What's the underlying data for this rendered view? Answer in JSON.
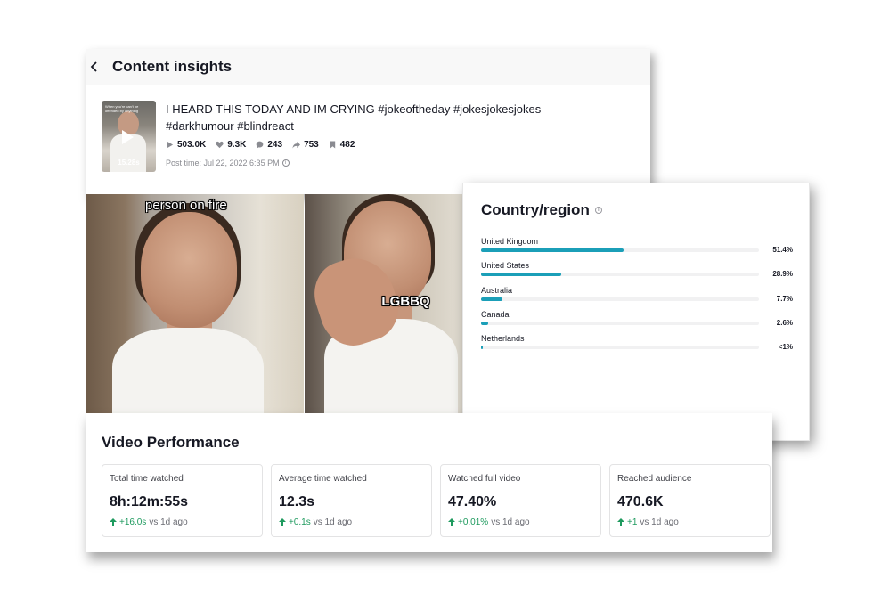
{
  "header": {
    "title": "Content insights",
    "back_icon": "chevron-left-icon"
  },
  "post": {
    "caption_line1": "I HEARD THIS TODAY AND IM CRYING #jokeoftheday #jokesjokesjokes",
    "caption_line2": "#darkhumour #blindreact",
    "thumbnail_caption": "When you're can't be offended by anything",
    "duration": "15.28s",
    "stats": {
      "views": "503.0K",
      "likes": "9.3K",
      "comments": "243",
      "shares": "753",
      "saves": "482"
    },
    "post_time": "Post time: Jul 22, 2022 6:35 PM"
  },
  "frames": {
    "overlay_1": "person on fire",
    "overlay_2": "LGBBQ"
  },
  "country": {
    "title": "Country/region",
    "accent_color": "#1b9fb8",
    "items": [
      {
        "name": "United Kingdom",
        "pct": "51.4%",
        "fraction": 0.514
      },
      {
        "name": "United States",
        "pct": "28.9%",
        "fraction": 0.289
      },
      {
        "name": "Australia",
        "pct": "7.7%",
        "fraction": 0.077
      },
      {
        "name": "Canada",
        "pct": "2.6%",
        "fraction": 0.026
      },
      {
        "name": "Netherlands",
        "pct": "<1%",
        "fraction": 0.008
      }
    ]
  },
  "performance": {
    "title": "Video Performance",
    "delta_color": "#1e9a5e",
    "metrics": [
      {
        "label": "Total time watched",
        "value": "8h:12m:55s",
        "delta": "+16.0s",
        "suffix": "vs 1d ago"
      },
      {
        "label": "Average time watched",
        "value": "12.3s",
        "delta": "+0.1s",
        "suffix": "vs 1d ago"
      },
      {
        "label": "Watched full video",
        "value": "47.40%",
        "delta": "+0.01%",
        "suffix": "vs 1d ago"
      },
      {
        "label": "Reached audience",
        "value": "470.6K",
        "delta": "+1",
        "suffix": "vs 1d ago"
      }
    ]
  }
}
